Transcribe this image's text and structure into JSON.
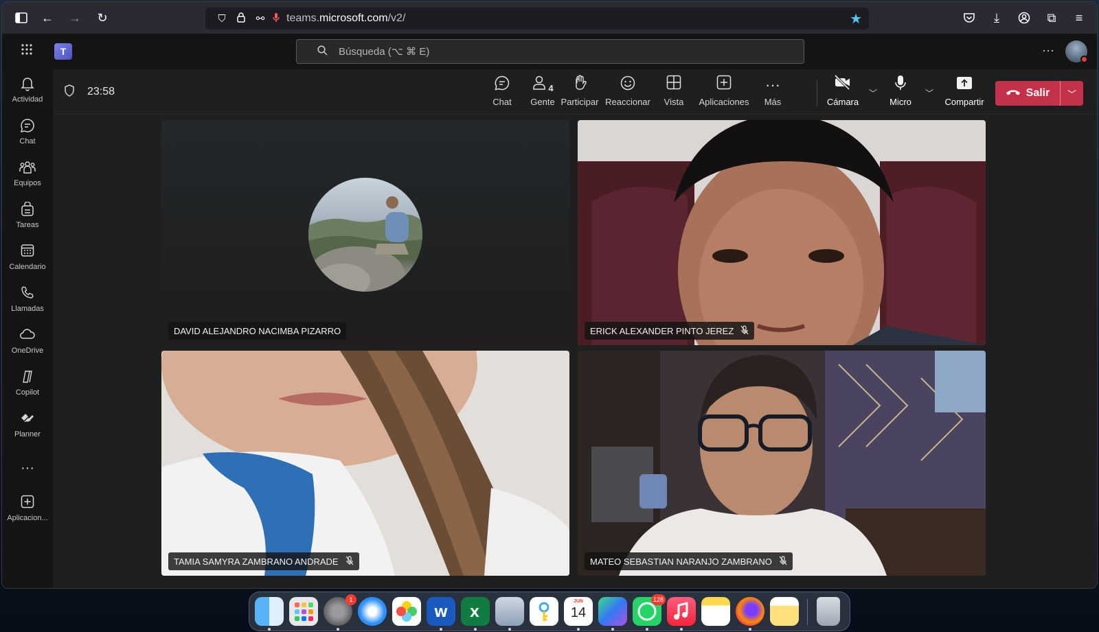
{
  "browser": {
    "url_prefix": "teams.",
    "url_domain": "microsoft.com",
    "url_path": "/v2/"
  },
  "teams": {
    "search_placeholder": "Búsqueda (⌥ ⌘ E)"
  },
  "rail": {
    "items": [
      {
        "label": "Actividad",
        "icon": "bell-icon"
      },
      {
        "label": "Chat",
        "icon": "chat-icon"
      },
      {
        "label": "Equipos",
        "icon": "teams-icon"
      },
      {
        "label": "Tareas",
        "icon": "tasks-icon"
      },
      {
        "label": "Calendario",
        "icon": "calendar-icon"
      },
      {
        "label": "Llamadas",
        "icon": "phone-icon"
      },
      {
        "label": "OneDrive",
        "icon": "cloud-icon"
      },
      {
        "label": "Copilot",
        "icon": "copilot-icon"
      },
      {
        "label": "Planner",
        "icon": "planner-icon"
      },
      {
        "label": "Aplicacion...",
        "icon": "add-app-icon"
      }
    ]
  },
  "meeting": {
    "timer": "23:58",
    "toolbar": {
      "chat": "Chat",
      "people": "Gente",
      "people_count": "4",
      "raise": "Participar",
      "react": "Reaccionar",
      "view": "Vista",
      "apps": "Aplicaciones",
      "more": "Más",
      "camera": "Cámara",
      "mic": "Micro",
      "share": "Compartir",
      "leave": "Salir"
    },
    "participants": [
      {
        "name": "DAVID ALEJANDRO NACIMBA PIZARRO",
        "muted": false
      },
      {
        "name": "ERICK ALEXANDER PINTO JEREZ",
        "muted": true
      },
      {
        "name": "TAMIA SAMYRA ZAMBRANO ANDRADE",
        "muted": true
      },
      {
        "name": "MATEO SEBASTIAN NARANJO ZAMBRANO",
        "muted": true
      }
    ]
  },
  "dock": {
    "calendar_month": "JUN",
    "calendar_day": "14",
    "settings_badge": "1",
    "whatsapp_badge": "128"
  },
  "colors": {
    "leave": "#c4314b",
    "accent": "#7b83eb",
    "star": "#56c4ff"
  }
}
